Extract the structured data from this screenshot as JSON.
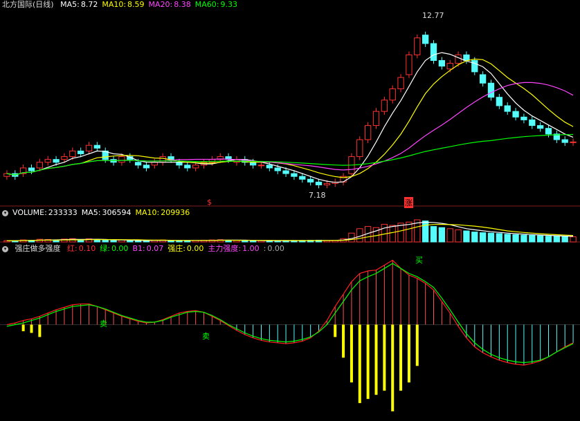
{
  "panels": {
    "price": {
      "title": "北方国际(日线)",
      "ma": [
        {
          "label": "MA5:",
          "value": "8.72",
          "color": "#ffffff"
        },
        {
          "label": "MA10:",
          "value": "8.59",
          "color": "#ffff00"
        },
        {
          "label": "MA20:",
          "value": "8.38",
          "color": "#ff44ff"
        },
        {
          "label": "MA60:",
          "value": "9.33",
          "color": "#00ff00"
        }
      ],
      "high_label": "12.77",
      "low_label": "7.18",
      "marker_s": "$",
      "marker_zhang": "涨"
    },
    "volume": {
      "items": [
        {
          "label": "VOLUME:",
          "value": "233333",
          "color": "#ffffff"
        },
        {
          "label": "MA5:",
          "value": "306594",
          "color": "#ffffff"
        },
        {
          "label": "MA10:",
          "value": "209936",
          "color": "#ffff00"
        }
      ]
    },
    "indicator": {
      "title": "强庄做多强度",
      "items": [
        {
          "label": "红:",
          "value": "0.10",
          "color": "#ff3030"
        },
        {
          "label": "绿:",
          "value": "0.00",
          "color": "#00ff00"
        },
        {
          "label": "B1:",
          "value": "0.07",
          "color": "#ff44ff"
        },
        {
          "label": "强庄:",
          "value": "0.00",
          "color": "#ffff00"
        },
        {
          "label": "主力强度:",
          "value": "1.00",
          "color": "#ff44ff"
        },
        {
          "label": ":",
          "value": "0.00",
          "color": "#aaaaaa"
        }
      ],
      "buy_label": "买",
      "sell_label": "卖"
    }
  },
  "colors": {
    "up": "#ff3232",
    "down": "#54fcfc",
    "ma5": "#ffffff",
    "ma10": "#ffff00",
    "ma20": "#ff44ff",
    "ma60": "#00ff00"
  },
  "chart_data": {
    "type": "candlestick",
    "price_range": [
      6.6,
      13.3
    ],
    "closes": [
      7.6,
      7.5,
      7.8,
      7.7,
      8.0,
      8.1,
      8.0,
      8.2,
      8.4,
      8.3,
      8.6,
      8.5,
      8.1,
      8.0,
      8.2,
      8.1,
      7.9,
      7.8,
      8.0,
      8.2,
      8.1,
      7.9,
      7.8,
      7.9,
      8.0,
      8.1,
      8.2,
      8.1,
      8.1,
      8.0,
      7.9,
      7.9,
      7.8,
      7.7,
      7.6,
      7.5,
      7.4,
      7.3,
      7.2,
      7.25,
      7.3,
      7.5,
      8.2,
      8.8,
      9.3,
      9.8,
      10.2,
      10.6,
      11.0,
      11.8,
      12.4,
      12.2,
      11.6,
      11.4,
      11.5,
      11.8,
      11.6,
      11.2,
      10.8,
      10.3,
      10.0,
      9.8,
      9.6,
      9.5,
      9.3,
      9.2,
      9.0,
      8.8,
      8.7,
      8.72
    ],
    "opens": [
      7.5,
      7.6,
      7.6,
      7.8,
      7.8,
      8.0,
      8.1,
      8.1,
      8.2,
      8.4,
      8.4,
      8.6,
      8.4,
      8.1,
      8.0,
      8.2,
      8.0,
      7.9,
      7.9,
      8.0,
      8.2,
      8.0,
      7.9,
      7.8,
      7.9,
      8.0,
      8.1,
      8.2,
      8.0,
      8.1,
      8.0,
      7.9,
      7.9,
      7.8,
      7.7,
      7.6,
      7.5,
      7.4,
      7.3,
      7.2,
      7.25,
      7.3,
      7.6,
      8.2,
      8.8,
      9.3,
      9.8,
      10.2,
      10.6,
      11.1,
      11.8,
      12.5,
      12.2,
      11.6,
      11.3,
      11.5,
      11.8,
      11.6,
      11.1,
      10.8,
      10.3,
      10.0,
      9.8,
      9.6,
      9.5,
      9.3,
      9.2,
      9.0,
      8.8,
      8.7
    ],
    "volume_range": [
      0,
      1000000
    ],
    "volumes": [
      60000,
      50000,
      90000,
      70000,
      120000,
      110000,
      80000,
      130000,
      150000,
      90000,
      140000,
      100000,
      80000,
      60000,
      90000,
      70000,
      50000,
      60000,
      80000,
      90000,
      70000,
      50000,
      60000,
      70000,
      80000,
      90000,
      100000,
      80000,
      70000,
      60000,
      50000,
      60000,
      55000,
      50000,
      60000,
      65000,
      70000,
      75000,
      80000,
      60000,
      70000,
      150000,
      400000,
      600000,
      700000,
      650000,
      800000,
      750000,
      850000,
      900000,
      1000000,
      950000,
      700000,
      650000,
      600000,
      550000,
      500000,
      450000,
      420000,
      400000,
      380000,
      350000,
      330000,
      310000,
      300000,
      280000,
      260000,
      250000,
      240000,
      233333
    ],
    "indicator_range": [
      -1.15,
      0.85
    ],
    "red": [
      0.0,
      0.02,
      0.05,
      0.07,
      0.1,
      0.14,
      0.18,
      0.21,
      0.24,
      0.25,
      0.25,
      0.22,
      0.18,
      0.14,
      0.1,
      0.07,
      0.04,
      0.02,
      0.03,
      0.06,
      0.1,
      0.14,
      0.16,
      0.17,
      0.15,
      0.1,
      0.05,
      -0.01,
      -0.07,
      -0.12,
      -0.16,
      -0.19,
      -0.21,
      -0.22,
      -0.23,
      -0.22,
      -0.2,
      -0.16,
      -0.08,
      0.05,
      0.22,
      0.37,
      0.52,
      0.62,
      0.65,
      0.66,
      0.72,
      0.78,
      0.68,
      0.6,
      0.56,
      0.5,
      0.42,
      0.28,
      0.14,
      -0.02,
      -0.16,
      -0.27,
      -0.34,
      -0.39,
      -0.43,
      -0.46,
      -0.48,
      -0.49,
      -0.47,
      -0.44,
      -0.39,
      -0.33,
      -0.27,
      -0.22
    ],
    "green": [
      -0.02,
      0.0,
      0.02,
      0.05,
      0.08,
      0.12,
      0.16,
      0.19,
      0.22,
      0.23,
      0.24,
      0.22,
      0.19,
      0.15,
      0.11,
      0.08,
      0.05,
      0.03,
      0.03,
      0.05,
      0.09,
      0.12,
      0.15,
      0.16,
      0.15,
      0.11,
      0.06,
      0.0,
      -0.05,
      -0.1,
      -0.14,
      -0.17,
      -0.19,
      -0.2,
      -0.21,
      -0.2,
      -0.18,
      -0.15,
      -0.09,
      0.0,
      0.14,
      0.28,
      0.42,
      0.53,
      0.58,
      0.62,
      0.68,
      0.74,
      0.68,
      0.62,
      0.58,
      0.52,
      0.45,
      0.32,
      0.18,
      0.03,
      -0.11,
      -0.22,
      -0.3,
      -0.36,
      -0.4,
      -0.43,
      -0.45,
      -0.46,
      -0.45,
      -0.43,
      -0.39,
      -0.33,
      -0.28,
      -0.23
    ],
    "strong_bars": [
      0.0,
      0.0,
      -0.08,
      -0.1,
      -0.15,
      0.0,
      0.0,
      0.0,
      0.0,
      0.0,
      0.0,
      0.0,
      0.0,
      0.0,
      0.0,
      0.0,
      0.0,
      0.0,
      0.0,
      0.0,
      0.0,
      0.0,
      0.0,
      0.0,
      0.0,
      0.0,
      0.0,
      0.0,
      0.0,
      0.0,
      0.0,
      0.0,
      0.0,
      0.0,
      0.0,
      0.0,
      0.0,
      0.0,
      0.0,
      0.0,
      -0.15,
      -0.4,
      -0.7,
      -0.95,
      -0.9,
      -0.85,
      -0.8,
      -1.05,
      -0.8,
      -0.7,
      -0.5,
      0.0,
      0.0,
      0.0,
      0.0,
      0.0,
      0.0,
      0.0,
      0.0,
      0.0,
      0.0,
      0.0,
      0.0,
      0.0,
      0.0,
      0.0,
      0.0,
      0.0,
      0.0,
      0.0
    ]
  }
}
